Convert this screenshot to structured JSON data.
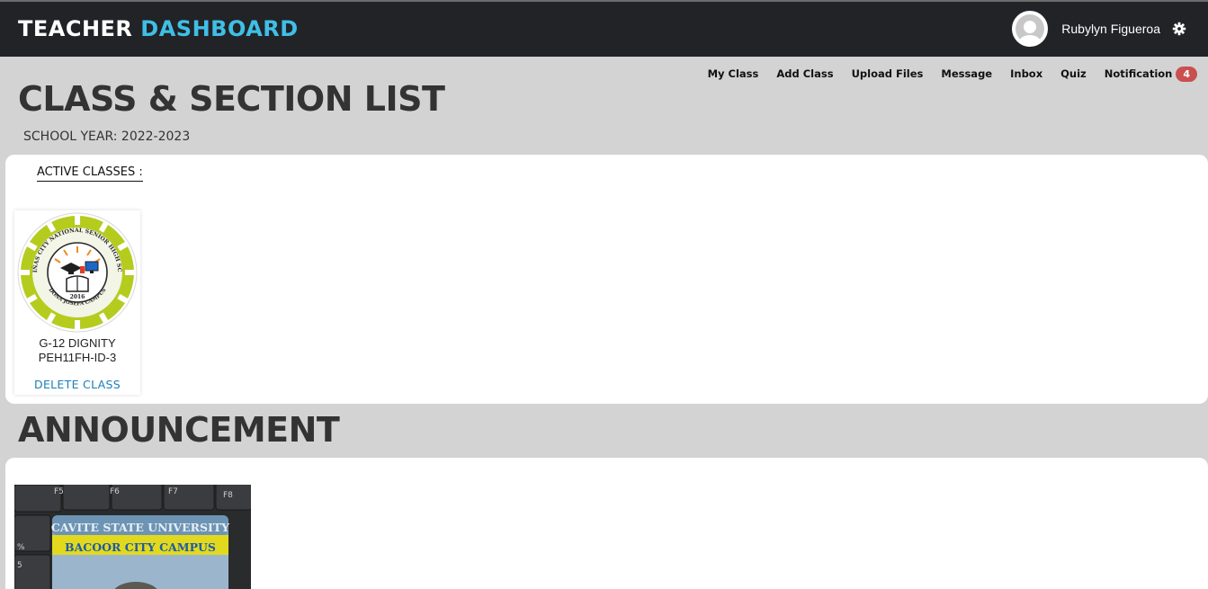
{
  "header": {
    "brand_primary": "TEACHER",
    "brand_accent": "DASHBOARD",
    "username": "Rubylyn Figueroa",
    "avatar_icon": "user-avatar-icon",
    "settings_icon": "gear-icon"
  },
  "nav": {
    "items": [
      {
        "label": "My Class"
      },
      {
        "label": "Add Class"
      },
      {
        "label": "Upload Files"
      },
      {
        "label": "Message"
      },
      {
        "label": "Inbox"
      },
      {
        "label": "Quiz"
      },
      {
        "label": "Notification"
      }
    ],
    "notification_count": "4"
  },
  "page": {
    "title": "CLASS & SECTION LIST",
    "school_year": "SCHOOL YEAR: 2022-2023"
  },
  "classes": {
    "section_label": "ACTIVE CLASSES :",
    "items": [
      {
        "name": "G-12 DIGNITY",
        "code": "PEH11FH-ID-3",
        "delete_label": "DELETE CLASS",
        "logo_ring_text": "LAS PIÑAS CITY NATIONAL SENIOR HIGH SCHOOL",
        "logo_bottom_text": "DOÑA JOSEFA CAMPUS",
        "logo_year": "2016"
      }
    ]
  },
  "announcement": {
    "title": "ANNOUNCEMENT",
    "image_card_line1": "CAVITE STATE UNIVERSITY",
    "image_card_line2": "BACOOR CITY CAMPUS",
    "key_labels": [
      "F5",
      "F6",
      "F7",
      "F8"
    ]
  },
  "colors": {
    "topbar_bg": "#222327",
    "brand_accent": "#3fbfe6",
    "page_bg": "#d3d3d3",
    "badge_bg": "#c9504f",
    "link_blue": "#1a7fb5",
    "logo_green": "#b5cc1f"
  }
}
